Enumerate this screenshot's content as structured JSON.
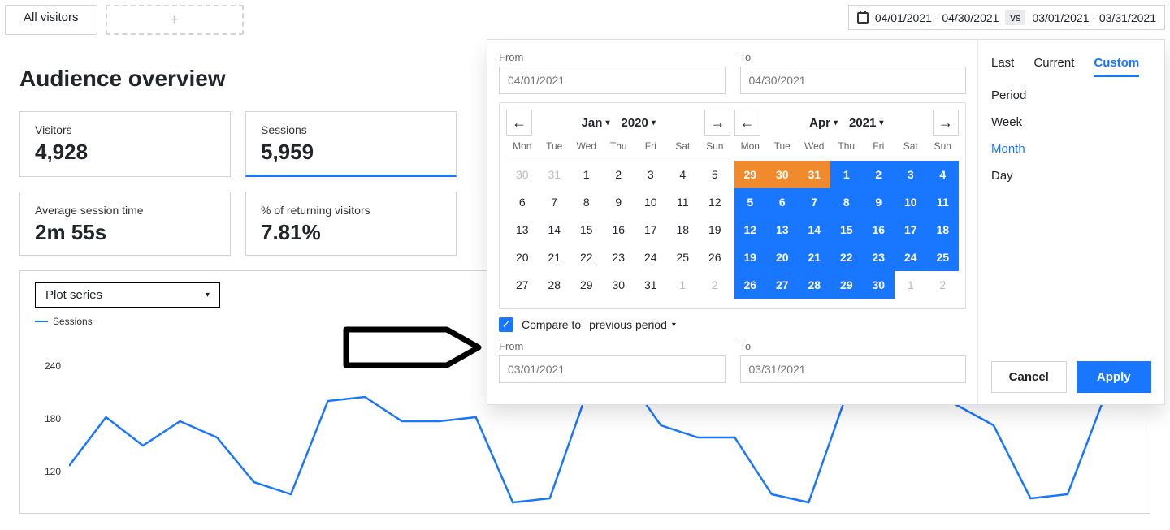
{
  "topbar": {
    "all_visitors_label": "All visitors",
    "add_icon": "+",
    "date_range_from": "04/01/2021 - 04/30/2021",
    "vs_label": "vs",
    "date_range_compare": "03/01/2021 - 03/31/2021"
  },
  "page_title": "Audience overview",
  "stats": {
    "visitors": {
      "label": "Visitors",
      "value": "4,928"
    },
    "sessions": {
      "label": "Sessions",
      "value": "5,959"
    },
    "avg_session": {
      "label": "Average session time",
      "value": "2m 55s"
    },
    "returning": {
      "label": "% of returning visitors",
      "value": "7.81%"
    }
  },
  "plot": {
    "dropdown_label": "Plot series",
    "legend_label": "Sessions",
    "y_ticks": [
      "240",
      "180",
      "120"
    ]
  },
  "chart_data": {
    "type": "line",
    "title": "Sessions",
    "xlabel": "",
    "ylabel": "",
    "ylim": [
      60,
      260
    ],
    "x": [
      1,
      2,
      3,
      4,
      5,
      6,
      7,
      8,
      9,
      10,
      11,
      12,
      13,
      14,
      15,
      16,
      17,
      18,
      19,
      20,
      21,
      22,
      23,
      24,
      25,
      26,
      27,
      28,
      29,
      30
    ],
    "series": [
      {
        "name": "Sessions",
        "values": [
          115,
          175,
          140,
          170,
          150,
          95,
          80,
          195,
          200,
          170,
          170,
          175,
          70,
          75,
          205,
          230,
          165,
          150,
          150,
          80,
          70,
          200,
          200,
          215,
          190,
          165,
          75,
          80,
          200,
          230
        ]
      }
    ]
  },
  "popover": {
    "from_label": "From",
    "to_label": "To",
    "from_placeholder": "04/01/2021",
    "to_placeholder": "04/30/2021",
    "left": {
      "month": "Jan",
      "year": "2020",
      "dow": [
        "Mon",
        "Tue",
        "Wed",
        "Thu",
        "Fri",
        "Sat",
        "Sun"
      ],
      "lead_muted": [
        "30",
        "31"
      ],
      "days": [
        "1",
        "2",
        "3",
        "4",
        "5",
        "6",
        "7",
        "8",
        "9",
        "10",
        "11",
        "12",
        "13",
        "14",
        "15",
        "16",
        "17",
        "18",
        "19",
        "20",
        "21",
        "22",
        "23",
        "24",
        "25",
        "26",
        "27",
        "28",
        "29",
        "30",
        "31"
      ],
      "trail_muted": [
        "1",
        "2"
      ]
    },
    "right": {
      "month": "Apr",
      "year": "2021",
      "dow": [
        "Mon",
        "Tue",
        "Wed",
        "Thu",
        "Fri",
        "Sat",
        "Sun"
      ],
      "lead_prev": [
        "29",
        "30",
        "31"
      ],
      "days_sel": [
        "1",
        "2",
        "3",
        "4",
        "5",
        "6",
        "7",
        "8",
        "9",
        "10",
        "11",
        "12",
        "13",
        "14",
        "15",
        "16",
        "17",
        "18",
        "19",
        "20",
        "21",
        "22",
        "23",
        "24",
        "25",
        "26",
        "27",
        "28",
        "29",
        "30"
      ],
      "trail_muted": [
        "1",
        "2"
      ]
    },
    "compare_label": "Compare to",
    "period_selected": "previous period",
    "compare_from_placeholder": "03/01/2021",
    "compare_to_placeholder": "03/31/2021",
    "tabs": [
      "Last",
      "Current",
      "Custom"
    ],
    "units": [
      "Period",
      "Week",
      "Month",
      "Day"
    ],
    "active_tab": "Custom",
    "active_unit": "Month",
    "cancel_label": "Cancel",
    "apply_label": "Apply"
  }
}
